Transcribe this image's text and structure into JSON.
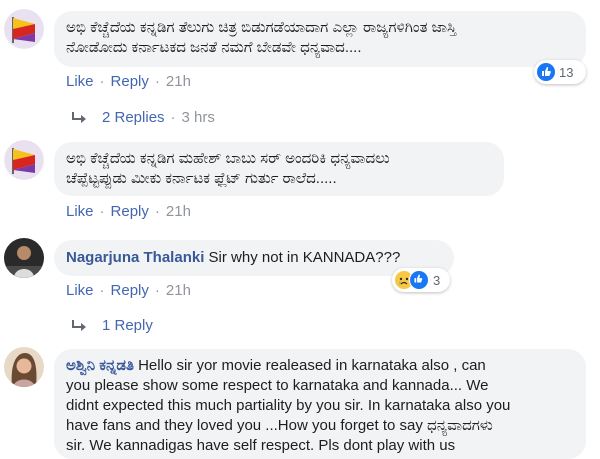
{
  "comments": [
    {
      "text_line1": "ಅಭಿ ಕೆಚ್ಚೆದೆಯ ಕನ್ನಡಿಗ ತೆಲುಗು ಚಿತ್ರ ಬಿಡುಗಡೆಯಾದಾಗ ಎಲ್ಲಾ ರಾಜ್ಯಗಳಿಗಿಂತ ಜಾಸ್ತಿ",
      "text_line2": "ನೋಡೋದು ಕರ್ನಾಟಕದ ಜನತೆ ನಮಗೆ ಬೇಡವೇ ಧನ್ಯವಾದ....",
      "like": "Like",
      "reply": "Reply",
      "time": "21h",
      "reaction_count": "13",
      "replies_label": "2 Replies",
      "replies_time": "3 hrs"
    },
    {
      "text_line1": "ಅಭಿ ಕೆಚ್ಚೆದೆಯ ಕನ್ನಡಿಗ ಮಹೇಶ್ ಬಾಬು ಸರ್ ಅಂದರಿಕಿ ಧನ್ಯವಾದಲು",
      "text_line2": "ಚೆಪ್ಪೆಟ್ಟಪ್ಪುಡು ಮೀಕು ಕರ್ನಾಟಕ ಫ್ಲೆಟ್ ಗುರ್ತು ರಾಲೆದ.....",
      "like": "Like",
      "reply": "Reply",
      "time": "21h"
    },
    {
      "author": "Nagarjuna Thalanki",
      "text": "Sir why not in KANNADA???",
      "like": "Like",
      "reply": "Reply",
      "time": "21h",
      "reaction_count": "3",
      "replies_label": "1 Reply"
    },
    {
      "author": "ಅಶ್ವಿನಿ ಕನ್ನಡತಿ",
      "text_line1": "Hello sir yor movie realeased in karnataka also , can",
      "text_line2": "you please show some respect to karnataka and kannada... We",
      "text_line3": "didnt expected this much partiality by you sir. In karnataka also you",
      "text_line4": "have fans and they loved you ...How you forget to say ಧನ್ಯವಾದಗಳು",
      "text_line5": "sir. We kannadigas have self respect. Pls dont play with us"
    }
  ],
  "colors": {
    "link": "#4267b2",
    "author": "#385898",
    "bubble": "#f2f3f5",
    "meta": "#90949c",
    "like_blue": "#1877f2",
    "sad_yellow": "#f7c844"
  }
}
